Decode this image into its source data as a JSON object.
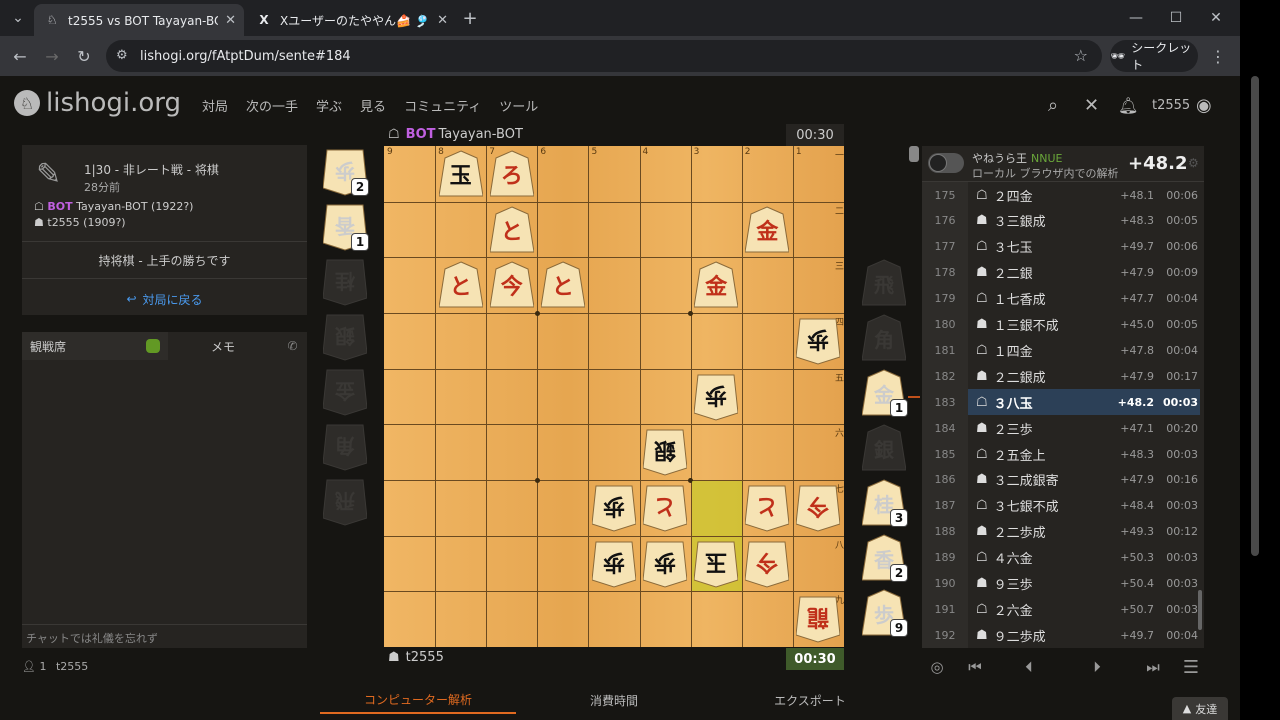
{
  "browser": {
    "tabs": [
      {
        "title": "t2555 vs BOT Tayayan-BOT: 棋譜",
        "icon": "lishogi-icon",
        "active": true
      },
      {
        "title": "Xユーザーのたややん🍰 🎐将棋AI",
        "icon": "x-icon",
        "active": false
      }
    ],
    "new_tab": "+",
    "url": "lishogi.org/fAtptDum/sente#184",
    "incognito_label": "シークレット"
  },
  "site": {
    "logo_text": "lishogi.org",
    "nav": [
      "対局",
      "次の一手",
      "学ぶ",
      "見る",
      "コミュニティ",
      "ツール"
    ],
    "username": "t2555"
  },
  "game_info": {
    "title": "1|30 - 非レート戦 - 将棋",
    "time_ago": "28分前",
    "gote_player": {
      "tag": "BOT",
      "name": "Tayayan-BOT (1922?)"
    },
    "sente_player": {
      "name": "t2555 (1909?)"
    },
    "result": "持将棋 - 上手の勝ちです",
    "back_button": "対局に戻る"
  },
  "chat": {
    "tab_spectators": "観戦席",
    "tab_notes": "メモ",
    "input_placeholder": "チャットでは礼儀を忘れず",
    "spectators_count": "1",
    "spectator_name": "t2555"
  },
  "top_player": {
    "tag": "BOT",
    "name": "Tayayan-BOT",
    "clock": "00:30"
  },
  "bottom_player": {
    "name": "t2555",
    "clock": "00:30"
  },
  "board": {
    "files": [
      "9",
      "8",
      "7",
      "6",
      "5",
      "4",
      "3",
      "2",
      "1"
    ],
    "ranks": [
      "一",
      "二",
      "三",
      "四",
      "五",
      "六",
      "七",
      "八",
      "九"
    ],
    "pieces": [
      {
        "f": 8,
        "r": 1,
        "k": "玉",
        "side": "sente",
        "promo": false
      },
      {
        "f": 7,
        "r": 1,
        "k": "ろ",
        "side": "sente",
        "promo": true
      },
      {
        "f": 7,
        "r": 2,
        "k": "と",
        "side": "sente",
        "promo": true
      },
      {
        "f": 2,
        "r": 2,
        "k": "金",
        "side": "sente",
        "promo": true
      },
      {
        "f": 8,
        "r": 3,
        "k": "と",
        "side": "sente",
        "promo": true
      },
      {
        "f": 7,
        "r": 3,
        "k": "今",
        "side": "sente",
        "promo": true
      },
      {
        "f": 6,
        "r": 3,
        "k": "と",
        "side": "sente",
        "promo": true
      },
      {
        "f": 3,
        "r": 3,
        "k": "金",
        "side": "sente",
        "promo": true
      },
      {
        "f": 1,
        "r": 4,
        "k": "歩",
        "side": "gote",
        "promo": false
      },
      {
        "f": 3,
        "r": 5,
        "k": "歩",
        "side": "gote",
        "promo": false
      },
      {
        "f": 4,
        "r": 6,
        "k": "銀",
        "side": "gote",
        "promo": false
      },
      {
        "f": 5,
        "r": 7,
        "k": "歩",
        "side": "gote",
        "promo": false
      },
      {
        "f": 4,
        "r": 7,
        "k": "と",
        "side": "gote",
        "promo": true
      },
      {
        "f": 2,
        "r": 7,
        "k": "と",
        "side": "gote",
        "promo": true
      },
      {
        "f": 1,
        "r": 7,
        "k": "今",
        "side": "gote",
        "promo": true
      },
      {
        "f": 5,
        "r": 8,
        "k": "歩",
        "side": "gote",
        "promo": false
      },
      {
        "f": 4,
        "r": 8,
        "k": "歩",
        "side": "gote",
        "promo": false
      },
      {
        "f": 3,
        "r": 8,
        "k": "玉",
        "side": "gote",
        "promo": false
      },
      {
        "f": 2,
        "r": 8,
        "k": "今",
        "side": "gote",
        "promo": true
      },
      {
        "f": 1,
        "r": 9,
        "k": "龍",
        "side": "gote",
        "promo": true
      }
    ],
    "highlights": [
      {
        "f": 3,
        "r": 7
      },
      {
        "f": 3,
        "r": 8
      }
    ]
  },
  "gote_hand": [
    {
      "k": "歩",
      "count": "2",
      "dim": false
    },
    {
      "k": "香",
      "count": "1",
      "dim": false
    },
    {
      "k": "桂",
      "count": "",
      "dim": true
    },
    {
      "k": "銀",
      "count": "",
      "dim": true
    },
    {
      "k": "金",
      "count": "",
      "dim": true
    },
    {
      "k": "角",
      "count": "",
      "dim": true
    },
    {
      "k": "飛",
      "count": "",
      "dim": true
    }
  ],
  "sente_hand": [
    {
      "k": "飛",
      "count": "",
      "dim": true
    },
    {
      "k": "角",
      "count": "",
      "dim": true
    },
    {
      "k": "金",
      "count": "1",
      "dim": false
    },
    {
      "k": "銀",
      "count": "",
      "dim": true
    },
    {
      "k": "桂",
      "count": "3",
      "dim": false
    },
    {
      "k": "香",
      "count": "2",
      "dim": false
    },
    {
      "k": "歩",
      "count": "9",
      "dim": false
    }
  ],
  "analysis": {
    "engine": "やねうら王",
    "engine_tag": "NNUE",
    "engine_sub": "ローカル ブラウザ内での解析",
    "score": "+48.2",
    "moves": [
      {
        "n": "175",
        "side": "gote",
        "mv": "２四金",
        "ev": "+48.1",
        "t": "00:06"
      },
      {
        "n": "176",
        "side": "sente",
        "mv": "３三銀成",
        "ev": "+48.3",
        "t": "00:05"
      },
      {
        "n": "177",
        "side": "gote",
        "mv": "３七玉",
        "ev": "+49.7",
        "t": "00:06"
      },
      {
        "n": "178",
        "side": "sente",
        "mv": "２二銀",
        "ev": "+47.9",
        "t": "00:09"
      },
      {
        "n": "179",
        "side": "gote",
        "mv": "１七香成",
        "ev": "+47.7",
        "t": "00:04"
      },
      {
        "n": "180",
        "side": "sente",
        "mv": "１三銀不成",
        "ev": "+45.0",
        "t": "00:05"
      },
      {
        "n": "181",
        "side": "gote",
        "mv": "１四金",
        "ev": "+47.8",
        "t": "00:04"
      },
      {
        "n": "182",
        "side": "sente",
        "mv": "２二銀成",
        "ev": "+47.9",
        "t": "00:17"
      },
      {
        "n": "183",
        "side": "gote",
        "mv": "３八玉",
        "ev": "+48.2",
        "t": "00:03"
      },
      {
        "n": "184",
        "side": "sente",
        "mv": "２三歩",
        "ev": "+47.1",
        "t": "00:20"
      },
      {
        "n": "185",
        "side": "gote",
        "mv": "２五金上",
        "ev": "+48.3",
        "t": "00:03"
      },
      {
        "n": "186",
        "side": "sente",
        "mv": "３二成銀寄",
        "ev": "+47.9",
        "t": "00:16"
      },
      {
        "n": "187",
        "side": "gote",
        "mv": "３七銀不成",
        "ev": "+48.4",
        "t": "00:03"
      },
      {
        "n": "188",
        "side": "sente",
        "mv": "２二歩成",
        "ev": "+49.3",
        "t": "00:12"
      },
      {
        "n": "189",
        "side": "gote",
        "mv": "４六金",
        "ev": "+50.3",
        "t": "00:03"
      },
      {
        "n": "190",
        "side": "sente",
        "mv": "９三歩",
        "ev": "+50.4",
        "t": "00:03"
      },
      {
        "n": "191",
        "side": "gote",
        "mv": "２六金",
        "ev": "+50.7",
        "t": "00:03"
      },
      {
        "n": "192",
        "side": "sente",
        "mv": "９二歩成",
        "ev": "+49.7",
        "t": "00:04"
      }
    ],
    "current": "183"
  },
  "bottom_tabs": [
    "コンピューター解析",
    "消費時間",
    "エクスポート"
  ],
  "friends_label": "友達"
}
